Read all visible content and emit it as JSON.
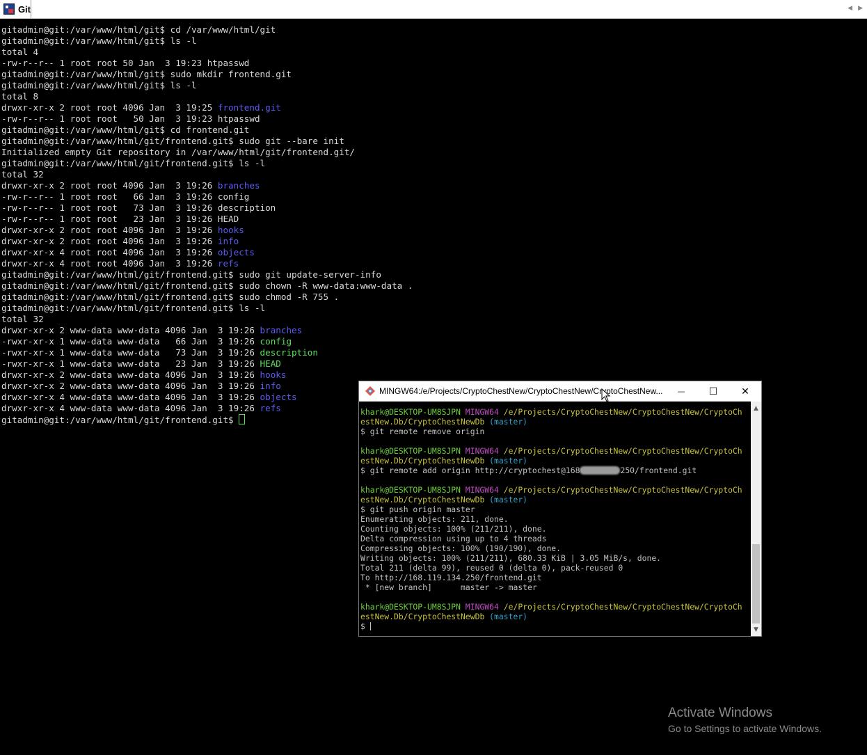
{
  "tab": {
    "label": "Git"
  },
  "main_terminal": {
    "lines": [
      [
        {
          "t": "gitadmin@git:/var/www/html/git$ cd /var/www/html/git"
        }
      ],
      [
        {
          "t": "gitadmin@git:/var/www/html/git$ ls -l"
        }
      ],
      [
        {
          "t": "total 4"
        }
      ],
      [
        {
          "t": "-rw-r--r-- 1 root root 50 Jan  3 19:23 htpasswd"
        }
      ],
      [
        {
          "t": "gitadmin@git:/var/www/html/git$ sudo mkdir frontend.git"
        }
      ],
      [
        {
          "t": "gitadmin@git:/var/www/html/git$ ls -l"
        }
      ],
      [
        {
          "t": "total 8"
        }
      ],
      [
        {
          "t": "drwxr-xr-x 2 root root 4096 Jan  3 19:25 "
        },
        {
          "t": "frontend.git",
          "c": "blue"
        }
      ],
      [
        {
          "t": "-rw-r--r-- 1 root root   50 Jan  3 19:23 htpasswd"
        }
      ],
      [
        {
          "t": "gitadmin@git:/var/www/html/git$ cd frontend.git"
        }
      ],
      [
        {
          "t": "gitadmin@git:/var/www/html/git/frontend.git$ sudo git --bare init"
        }
      ],
      [
        {
          "t": "Initialized empty Git repository in /var/www/html/git/frontend.git/"
        }
      ],
      [
        {
          "t": "gitadmin@git:/var/www/html/git/frontend.git$ ls -l"
        }
      ],
      [
        {
          "t": "total 32"
        }
      ],
      [
        {
          "t": "drwxr-xr-x 2 root root 4096 Jan  3 19:26 "
        },
        {
          "t": "branches",
          "c": "blue"
        }
      ],
      [
        {
          "t": "-rw-r--r-- 1 root root   66 Jan  3 19:26 config"
        }
      ],
      [
        {
          "t": "-rw-r--r-- 1 root root   73 Jan  3 19:26 description"
        }
      ],
      [
        {
          "t": "-rw-r--r-- 1 root root   23 Jan  3 19:26 HEAD"
        }
      ],
      [
        {
          "t": "drwxr-xr-x 2 root root 4096 Jan  3 19:26 "
        },
        {
          "t": "hooks",
          "c": "blue"
        }
      ],
      [
        {
          "t": "drwxr-xr-x 2 root root 4096 Jan  3 19:26 "
        },
        {
          "t": "info",
          "c": "blue"
        }
      ],
      [
        {
          "t": "drwxr-xr-x 4 root root 4096 Jan  3 19:26 "
        },
        {
          "t": "objects",
          "c": "blue"
        }
      ],
      [
        {
          "t": "drwxr-xr-x 4 root root 4096 Jan  3 19:26 "
        },
        {
          "t": "refs",
          "c": "blue"
        }
      ],
      [
        {
          "t": "gitadmin@git:/var/www/html/git/frontend.git$ sudo git update-server-info"
        }
      ],
      [
        {
          "t": "gitadmin@git:/var/www/html/git/frontend.git$ sudo chown -R www-data:www-data ."
        }
      ],
      [
        {
          "t": "gitadmin@git:/var/www/html/git/frontend.git$ sudo chmod -R 755 ."
        }
      ],
      [
        {
          "t": "gitadmin@git:/var/www/html/git/frontend.git$ ls -l"
        }
      ],
      [
        {
          "t": "total 32"
        }
      ],
      [
        {
          "t": "drwxr-xr-x 2 www-data www-data 4096 Jan  3 19:26 "
        },
        {
          "t": "branches",
          "c": "blue"
        }
      ],
      [
        {
          "t": "-rwxr-xr-x 1 www-data www-data   66 Jan  3 19:26 "
        },
        {
          "t": "config",
          "c": "green"
        }
      ],
      [
        {
          "t": "-rwxr-xr-x 1 www-data www-data   73 Jan  3 19:26 "
        },
        {
          "t": "description",
          "c": "green"
        }
      ],
      [
        {
          "t": "-rwxr-xr-x 1 www-data www-data   23 Jan  3 19:26 "
        },
        {
          "t": "HEAD",
          "c": "green"
        }
      ],
      [
        {
          "t": "drwxr-xr-x 2 www-data www-data 4096 Jan  3 19:26 "
        },
        {
          "t": "hooks",
          "c": "blue"
        }
      ],
      [
        {
          "t": "drwxr-xr-x 2 www-data www-data 4096 Jan  3 19:26 "
        },
        {
          "t": "info",
          "c": "blue"
        }
      ],
      [
        {
          "t": "drwxr-xr-x 4 www-data www-data 4096 Jan  3 19:26 "
        },
        {
          "t": "objects",
          "c": "blue"
        }
      ],
      [
        {
          "t": "drwxr-xr-x 4 www-data www-data 4096 Jan  3 19:26 "
        },
        {
          "t": "refs",
          "c": "blue"
        }
      ],
      [
        {
          "t": "gitadmin@git:/var/www/html/git/frontend.git$ "
        },
        {
          "cursor": true
        }
      ]
    ]
  },
  "mingw_window": {
    "title": "MINGW64:/e/Projects/CryptoChestNew/CryptoChestNew/CryptoChestNew...",
    "minimize_symbol": "—",
    "maximize_symbol": "☐",
    "close_symbol": "✕",
    "lines": [
      [
        {
          "t": "khark@DESKTOP-UM8SJPN ",
          "c": "mg"
        },
        {
          "t": "MINGW64 ",
          "c": "mm"
        },
        {
          "t": "/e/Projects/CryptoChestNew/CryptoChestNew/CryptoCh",
          "c": "my"
        }
      ],
      [
        {
          "t": "estNew.Db/CryptoChestNewDb ",
          "c": "my"
        },
        {
          "t": "(master)",
          "c": "mc"
        }
      ],
      [
        {
          "t": "$ git remote remove origin"
        }
      ],
      [
        {
          "t": ""
        }
      ],
      [
        {
          "t": "khark@DESKTOP-UM8SJPN ",
          "c": "mg"
        },
        {
          "t": "MINGW64 ",
          "c": "mm"
        },
        {
          "t": "/e/Projects/CryptoChestNew/CryptoChestNew/CryptoCh",
          "c": "my"
        }
      ],
      [
        {
          "t": "estNew.Db/CryptoChestNewDb ",
          "c": "my"
        },
        {
          "t": "(master)",
          "c": "mc"
        }
      ],
      [
        {
          "t": "$ git remote add origin http://cryptochest@168"
        },
        {
          "blur": true
        },
        {
          "t": "250/frontend.git"
        }
      ],
      [
        {
          "t": ""
        }
      ],
      [
        {
          "t": "khark@DESKTOP-UM8SJPN ",
          "c": "mg"
        },
        {
          "t": "MINGW64 ",
          "c": "mm"
        },
        {
          "t": "/e/Projects/CryptoChestNew/CryptoChestNew/CryptoCh",
          "c": "my"
        }
      ],
      [
        {
          "t": "estNew.Db/CryptoChestNewDb ",
          "c": "my"
        },
        {
          "t": "(master)",
          "c": "mc"
        }
      ],
      [
        {
          "t": "$ git push origin master"
        }
      ],
      [
        {
          "t": "Enumerating objects: 211, done."
        }
      ],
      [
        {
          "t": "Counting objects: 100% (211/211), done."
        }
      ],
      [
        {
          "t": "Delta compression using up to 4 threads"
        }
      ],
      [
        {
          "t": "Compressing objects: 100% (190/190), done."
        }
      ],
      [
        {
          "t": "Writing objects: 100% (211/211), 680.33 KiB | 3.05 MiB/s, done."
        }
      ],
      [
        {
          "t": "Total 211 (delta 99), reused 0 (delta 0), pack-reused 0"
        }
      ],
      [
        {
          "t": "To http://168.119.134.250/frontend.git"
        }
      ],
      [
        {
          "t": " * [new branch]      master -> master"
        }
      ],
      [
        {
          "t": ""
        }
      ],
      [
        {
          "t": "khark@DESKTOP-UM8SJPN ",
          "c": "mg"
        },
        {
          "t": "MINGW64 ",
          "c": "mm"
        },
        {
          "t": "/e/Projects/CryptoChestNew/CryptoChestNew/CryptoCh",
          "c": "my"
        }
      ],
      [
        {
          "t": "estNew.Db/CryptoChestNewDb ",
          "c": "my"
        },
        {
          "t": "(master)",
          "c": "mc"
        }
      ],
      [
        {
          "t": "$ "
        },
        {
          "cursor": true
        }
      ]
    ]
  },
  "watermark": {
    "title": "Activate Windows",
    "subtitle": "Go to Settings to activate Windows."
  }
}
